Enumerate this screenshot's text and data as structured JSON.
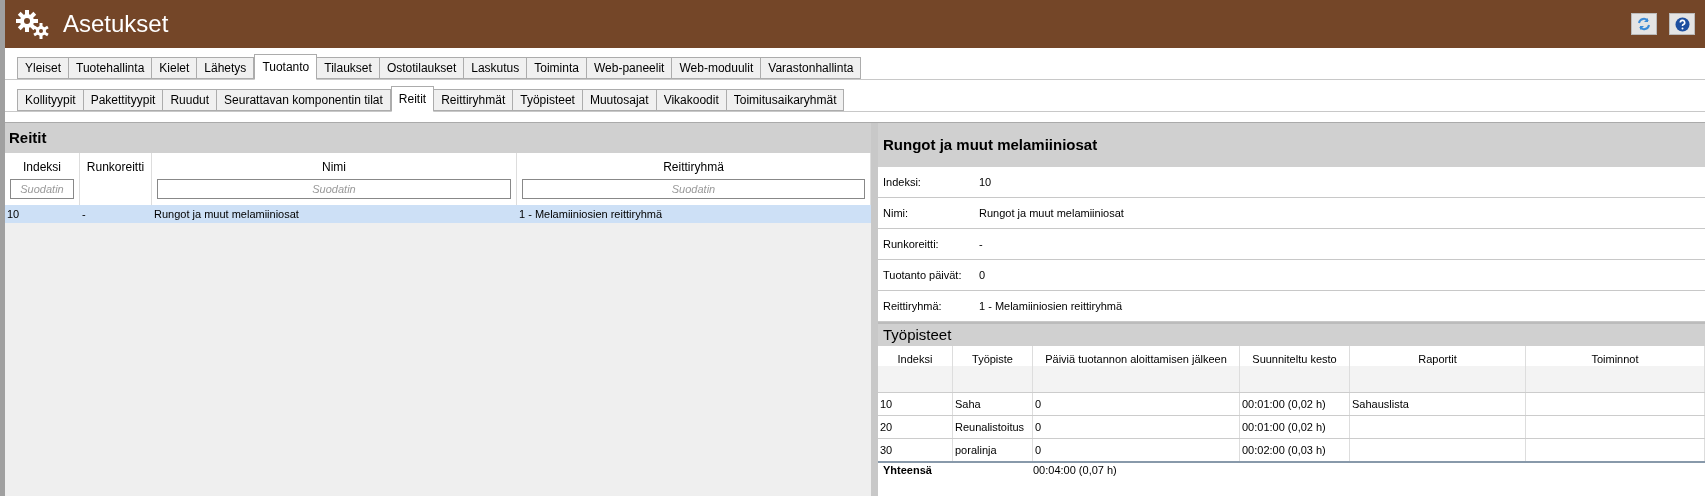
{
  "window": {
    "title": "Asetukset"
  },
  "main_tabs": [
    {
      "label": "Yleiset",
      "selected": false
    },
    {
      "label": "Tuotehallinta",
      "selected": false
    },
    {
      "label": "Kielet",
      "selected": false
    },
    {
      "label": "Lähetys",
      "selected": false
    },
    {
      "label": "Tuotanto",
      "selected": true
    },
    {
      "label": "Tilaukset",
      "selected": false
    },
    {
      "label": "Ostotilaukset",
      "selected": false
    },
    {
      "label": "Laskutus",
      "selected": false
    },
    {
      "label": "Toiminta",
      "selected": false
    },
    {
      "label": "Web-paneelit",
      "selected": false
    },
    {
      "label": "Web-moduulit",
      "selected": false
    },
    {
      "label": "Varastonhallinta",
      "selected": false
    }
  ],
  "sub_tabs": [
    {
      "label": "Kollityypit",
      "selected": false
    },
    {
      "label": "Pakettityypit",
      "selected": false
    },
    {
      "label": "Ruudut",
      "selected": false
    },
    {
      "label": "Seurattavan komponentin tilat",
      "selected": false
    },
    {
      "label": "Reitit",
      "selected": true
    },
    {
      "label": "Reittiryhmät",
      "selected": false
    },
    {
      "label": "Työpisteet",
      "selected": false
    },
    {
      "label": "Muutosajat",
      "selected": false
    },
    {
      "label": "Vikakoodit",
      "selected": false
    },
    {
      "label": "Toimitusaikaryhmät",
      "selected": false
    }
  ],
  "routes": {
    "title": "Reitit",
    "columns": [
      {
        "label": "Indeksi",
        "placeholder": "Suodatin"
      },
      {
        "label": "Runkoreitti"
      },
      {
        "label": "Nimi",
        "placeholder": "Suodatin"
      },
      {
        "label": "Reittiryhmä",
        "placeholder": "Suodatin"
      }
    ],
    "rows": [
      {
        "cells": [
          "10",
          "-",
          "Rungot ja muut melamiiniosat",
          "1 - Melamiiniosien reittiryhmä"
        ],
        "selected": true
      }
    ]
  },
  "details": {
    "title": "Rungot ja muut melamiiniosat",
    "fields": [
      {
        "label": "Indeksi:",
        "value": "10"
      },
      {
        "label": "Nimi:",
        "value": "Rungot ja muut melamiiniosat"
      },
      {
        "label": "Runkoreitti:",
        "value": "-"
      },
      {
        "label": "Tuotanto päivät:",
        "value": "0"
      },
      {
        "label": "Reittiryhmä:",
        "value": "1 - Melamiiniosien reittiryhmä"
      }
    ]
  },
  "workstations": {
    "title": "Työpisteet",
    "columns": [
      "Indeksi",
      "Työpiste",
      "Päiviä tuotannon aloittamisen jälkeen",
      "Suunniteltu kesto",
      "Raportit",
      "Toiminnot"
    ],
    "rows": [
      [
        "10",
        "Saha",
        "0",
        "00:01:00 (0,02 h)",
        "Sahauslista"
      ],
      [
        "20",
        "Reunalistoitus",
        "0",
        "00:01:00 (0,02 h)"
      ],
      [
        "30",
        "poralinja",
        "0",
        "00:02:00 (0,03 h)"
      ]
    ],
    "total": {
      "label": "Yhteensä",
      "value": "00:04:00 (0,07 h)"
    }
  }
}
